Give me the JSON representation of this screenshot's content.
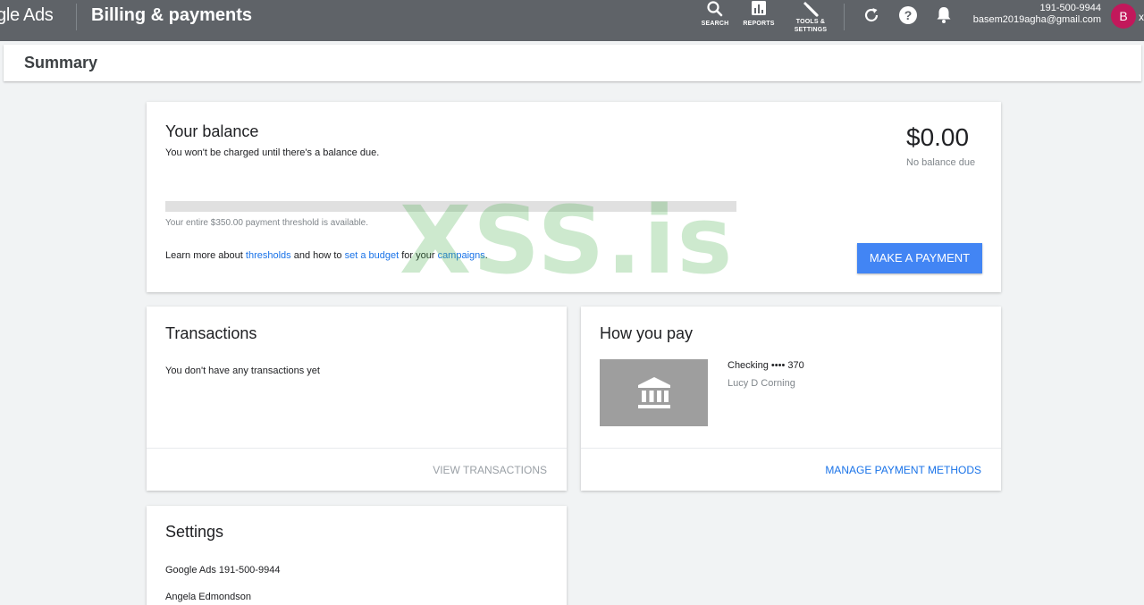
{
  "topbar": {
    "brand": "gle Ads",
    "page_title": "Billing & payments",
    "tools": [
      {
        "label": "SEARCH",
        "icon": "search-icon"
      },
      {
        "label": "REPORTS",
        "icon": "reports-icon"
      },
      {
        "label_line1": "TOOLS &",
        "label_line2": "SETTINGS",
        "icon": "wrench-icon"
      }
    ],
    "account_id": "191-500-9944",
    "account_email": "basem2019agha@gmail.com",
    "avatar_initial": "B",
    "avatar_color": "#c2185b"
  },
  "summary": {
    "title": "Summary"
  },
  "balance": {
    "title": "Your balance",
    "subtitle": "You won't be charged until there's a balance due.",
    "amount": "$0.00",
    "status": "No balance due",
    "threshold_text": "Your entire $350.00 payment threshold is available.",
    "threshold_used_fraction": 0,
    "learn_prefix": "Learn more about ",
    "learn_link1": "thresholds",
    "learn_middle": " and how to ",
    "learn_link2": "set a budget",
    "learn_middle2": " for your ",
    "learn_link3": "campaigns",
    "learn_suffix": ".",
    "button": "MAKE A PAYMENT"
  },
  "watermark": "XSS.is",
  "transactions": {
    "title": "Transactions",
    "empty": "You don't have any transactions yet",
    "action": "VIEW TRANSACTIONS"
  },
  "payment": {
    "title": "How you pay",
    "method": "Checking •••• 370",
    "holder": "Lucy D Corning",
    "action": "MANAGE PAYMENT METHODS",
    "icon": "bank-icon"
  },
  "settings": {
    "title": "Settings",
    "account": "Google Ads 191-500-9944",
    "name": "Angela Edmondson"
  },
  "colors": {
    "topbar": "#5f6368",
    "primary": "#4285f4",
    "link": "#1a73e8"
  }
}
